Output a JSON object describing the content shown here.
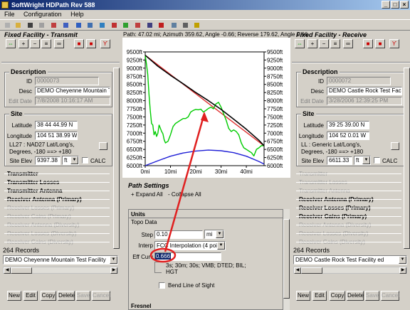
{
  "window": {
    "title": "SoftWright HDPath Rev 588",
    "min": "_",
    "max": "□",
    "close": "×"
  },
  "menu": [
    "File",
    "Configuration",
    "Help"
  ],
  "path_info": "Path: 47.02 mi; Azimuth 359.62, Angle -0.66; Reverse 179.62, Angle 0.66",
  "left": {
    "title": "Fixed Facility - Transmit",
    "description_title": "Description",
    "id_label": "ID",
    "id_value": "0000073",
    "desc_label": "Desc",
    "desc_value": "DEMO Cheyenne Mountain Te",
    "edit_label": "Edit Date",
    "edit_value": "7/8/2008 10:16:17 AM",
    "site_title": "Site",
    "lat_label": "Latitude",
    "lat_value": "38 44 44.99 N",
    "lon_label": "Longitude",
    "lon_value": "104 51 38.99 W",
    "datum": "LL27 : NAD27 Lat/Long's, Degrees, -180 ==> +180",
    "elev_label": "Site Elev",
    "elev_value": "9397.38",
    "elev_unit": "ft",
    "calc": "CALC",
    "sections": [
      {
        "label": "Transmitter",
        "style": "bold"
      },
      {
        "label": "Transmitter Losses",
        "style": "bold"
      },
      {
        "label": "Transmitter Antenna",
        "style": "bold"
      },
      {
        "label": "Receiver Antenna (Primary)",
        "style": "bold"
      },
      {
        "label": "Receiver Losses (Primary)",
        "style": "dim"
      },
      {
        "label": "Receiver Gains (Primary)",
        "style": "dim"
      },
      {
        "label": "Receiver Antenna (Diversity)",
        "style": "dim"
      },
      {
        "label": "Receiver Losses (Diversity)",
        "style": "dim"
      },
      {
        "label": "Receiver Gains (Diversity)",
        "style": "dim"
      }
    ],
    "records": "264 Records",
    "selected": "DEMO Cheyenne Mountain Test Facility",
    "buttons": [
      "New",
      "Edit",
      "Copy",
      "Delete",
      "Save",
      "Cancel"
    ]
  },
  "right": {
    "title": "Fixed Facility - Receive",
    "description_title": "Description",
    "id_label": "ID",
    "id_value": "0000072",
    "desc_label": "Desc",
    "desc_value": "DEMO Castle Rock Test Facilit",
    "edit_label": "Edit Date",
    "edit_value": "3/28/2006 12:39:25 PM",
    "site_title": "Site",
    "lat_label": "Latitude",
    "lat_value": "39 25 39.00 N",
    "lon_label": "Longitude",
    "lon_value": "104 52 0.01 W",
    "datum": "LL : Generic Lat/Long's, Degrees, -180 ==> +180",
    "elev_label": "Site Elev",
    "elev_value": "6611.33",
    "elev_unit": "ft",
    "calc": "CALC",
    "sections": [
      {
        "label": "Transmitter",
        "style": "dim"
      },
      {
        "label": "Transmitter Losses",
        "style": "dim"
      },
      {
        "label": "Transmitter Antenna",
        "style": "dim"
      },
      {
        "label": "Receiver Antenna (Primary)",
        "style": "bold"
      },
      {
        "label": "Receiver Losses (Primary)",
        "style": "bold"
      },
      {
        "label": "Receiver Gains (Primary)",
        "style": "bold"
      },
      {
        "label": "Receiver Antenna (Diversity)",
        "style": "dim"
      },
      {
        "label": "Receiver Losses (Diversity)",
        "style": "dim"
      },
      {
        "label": "Receiver Gains (Diversity)",
        "style": "dim"
      }
    ],
    "records": "264 Records",
    "selected": "DEMO Castle Rock Test Facility ed",
    "buttons": [
      "New",
      "Edit",
      "Copy",
      "Delete",
      "Save",
      "Cancel"
    ]
  },
  "settings": {
    "title": "Path Settings",
    "expand": "+ Expand All",
    "collapse": "- Collapse All",
    "units": "Units",
    "topo": "Topo Data",
    "step_label": "Step",
    "step_value": "0.10",
    "step_unit": "mi",
    "interp_label": "Interp",
    "interp_value": "FCC Interpolation (4 points)",
    "effcurv_label": "Eff Curv",
    "effcurv_value": "0.666",
    "sources": "3s; 30m; 30s; VMB; DTED; BIL; HGT",
    "bend": "Bend Line of Sight",
    "next": "Fresnel"
  },
  "accent": {
    "terrain": "#00cc00",
    "earth": "#1f1fd6",
    "los": "#e03030",
    "fresnel": "#000000",
    "annotation": "#e02020"
  },
  "chart_data": {
    "type": "line",
    "x_ticks": [
      "0mi",
      "10mi",
      "20mi",
      "30mi",
      "40mi"
    ],
    "y_ticks": [
      "9500ft",
      "9250ft",
      "9000ft",
      "8750ft",
      "8500ft",
      "8250ft",
      "8000ft",
      "7750ft",
      "7500ft",
      "7250ft",
      "7000ft",
      "6750ft",
      "6500ft",
      "6250ft",
      "6000ft"
    ],
    "xlim": [
      0,
      47.02
    ],
    "ylim": [
      6000,
      9500
    ],
    "series": [
      {
        "key": "terrain",
        "color": "#00cc00",
        "x": [
          0,
          0.5,
          1,
          1.5,
          2,
          2.5,
          3,
          3.5,
          4,
          4.5,
          5,
          5.5,
          6,
          6.5,
          7,
          7.5,
          8,
          9,
          10,
          11,
          12,
          13,
          14,
          15,
          16,
          17,
          18,
          19,
          20,
          21,
          22,
          23,
          24,
          25,
          26,
          27,
          28,
          29,
          30,
          31,
          32,
          33,
          34,
          35,
          36,
          37,
          38,
          39,
          40,
          41,
          42,
          43,
          44,
          45,
          46,
          47
        ],
        "y": [
          9397,
          9120,
          8800,
          8200,
          7700,
          7300,
          7250,
          6950,
          7050,
          6900,
          7000,
          7250,
          7150,
          7050,
          6980,
          6800,
          6700,
          6750,
          6950,
          7200,
          7300,
          7350,
          7400,
          7450,
          7450,
          7500,
          7650,
          7700,
          7730,
          7720,
          7740,
          7650,
          7700,
          7760,
          7800,
          7750,
          7900,
          7950,
          7800,
          7600,
          7400,
          7150,
          7050,
          7100,
          7050,
          6950,
          6700,
          6550,
          6500,
          6450,
          6400,
          6300,
          6500,
          6550,
          6620,
          6611
        ]
      },
      {
        "key": "los",
        "color": "#e03030",
        "x": [
          0,
          47.02
        ],
        "y": [
          9397,
          6611
        ]
      },
      {
        "key": "fresnel",
        "color": "#000000",
        "x": [
          0,
          5,
          10,
          15,
          20,
          25,
          30,
          35,
          40,
          45,
          47.02
        ],
        "y": [
          9397,
          9060,
          8780,
          8520,
          8250,
          8000,
          7730,
          7430,
          7120,
          6780,
          6611
        ]
      },
      {
        "key": "earth",
        "color": "#1f1fd6",
        "x": [
          0,
          5,
          10,
          15,
          20,
          25,
          30,
          35,
          40,
          45,
          47.02
        ],
        "y": [
          6000,
          6150,
          6290,
          6390,
          6450,
          6480,
          6460,
          6400,
          6290,
          6130,
          6050
        ]
      }
    ]
  }
}
